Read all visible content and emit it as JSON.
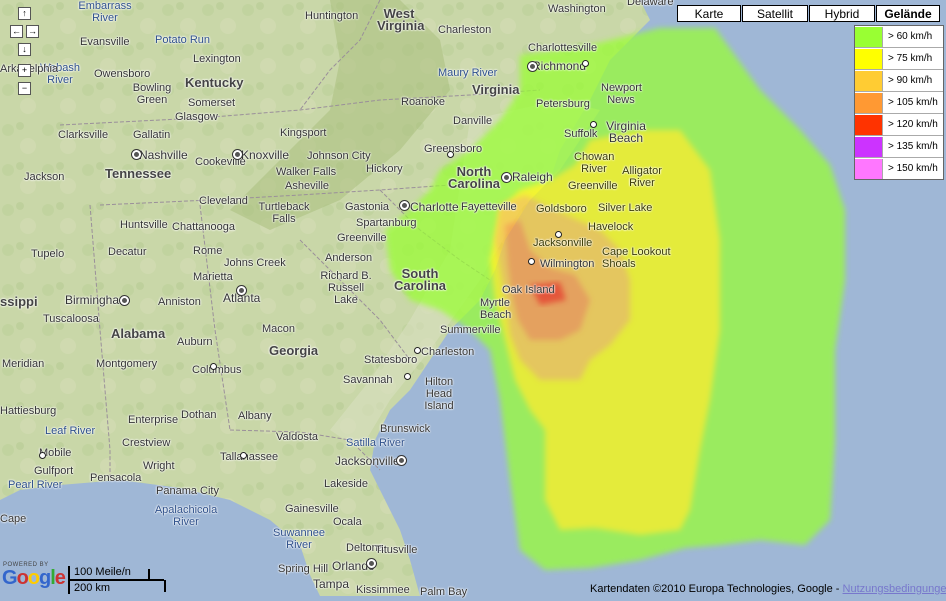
{
  "map_type_buttons": [
    {
      "label": "Karte",
      "active": false
    },
    {
      "label": "Satellit",
      "active": false
    },
    {
      "label": "Hybrid",
      "active": false
    },
    {
      "label": "Gelände",
      "active": true
    }
  ],
  "legend": [
    {
      "label": "> 60 km/h",
      "color": "#99ff33"
    },
    {
      "label": "> 75 km/h",
      "color": "#ffff00"
    },
    {
      "label": "> 90 km/h",
      "color": "#ffcc33"
    },
    {
      "label": "> 105 km/h",
      "color": "#ff9933"
    },
    {
      "label": "> 120 km/h",
      "color": "#ff3300"
    },
    {
      "label": "> 135 km/h",
      "color": "#cc33ff"
    },
    {
      "label": "> 150 km/h",
      "color": "#ff77ff"
    }
  ],
  "nav": {
    "up": "↑",
    "left": "←",
    "right": "→",
    "down": "↓",
    "zoom_in": "+",
    "zoom_out": "−"
  },
  "scale": {
    "top": "100 Meile/n",
    "bottom": "200 km"
  },
  "logo": {
    "powered_by": "POWERED BY",
    "word": "Google"
  },
  "attribution": {
    "text": "Kartendaten ©2010 Europa Technologies, Google - ",
    "link": "Nutzungsbedingungen"
  },
  "states": [
    "West Virginia",
    "Kentucky",
    "Virginia",
    "Tennessee",
    "North Carolina",
    "South Carolina",
    "Alabama",
    "Georgia",
    "ssippi"
  ],
  "cities": [
    "Washington",
    "Delaware",
    "Huntington",
    "Charleston",
    "Charlottesville",
    "Embarrass River",
    "Evansville",
    "Potato Run",
    "Lexington",
    "Maury River",
    "Richmond",
    "Wabash River",
    "Owensboro",
    "Bowling Green",
    "Somerset",
    "Glasgow",
    "Roanoke",
    "Petersburg",
    "Newport News",
    "Danville",
    "Virginia Beach",
    "Suffolk",
    "Clarksville",
    "Gallatin",
    "Kingsport",
    "Johnson City",
    "Greensboro",
    "Nashville",
    "Cookeville",
    "Knoxville",
    "Walker Falls",
    "Hickory",
    "Asheville",
    "Chowan River",
    "Alligator River",
    "Raleigh",
    "Greenville",
    "Jackson",
    "Cleveland",
    "Turtleback Falls",
    "Gastonia",
    "Charlotte",
    "Fayetteville",
    "Goldsboro",
    "Silver Lake",
    "Huntsville",
    "Chattanooga",
    "Spartanburg",
    "Havelock",
    "Jacksonville",
    "Tupelo",
    "Decatur",
    "Rome",
    "Greenville",
    "Cape Lookout Shoals",
    "Johns Creek",
    "Marietta",
    "Anderson",
    "Wilmington",
    "Atlanta",
    "Richard B. Russell Lake",
    "Oak Island",
    "Birmingham",
    "Anniston",
    "Myrtle Beach",
    "Tuscaloosa",
    "Summerville",
    "Macon",
    "Auburn",
    "Charleston",
    "Meridian",
    "Montgomery",
    "Columbus",
    "Statesboro",
    "Savannah",
    "Hilton Head Island",
    "Hattiesburg",
    "Enterprise",
    "Dothan",
    "Albany",
    "Leaf River",
    "Crestview",
    "Valdosta",
    "Satilla River",
    "Brunswick",
    "Mobile",
    "Gulfport",
    "Wright",
    "Tallahassee",
    "Jacksonville",
    "Pearl River",
    "Pensacola",
    "Lakeside",
    "Panama City",
    "Apalachicola River",
    "Gainesville",
    "Ocala",
    "Suwannee River",
    "Deltona",
    "Titusville",
    "Spring Hill",
    "Orlando",
    "Tampa",
    "Kissimmee",
    "Palm Bay",
    "Cape",
    "Arkadelphia"
  ]
}
